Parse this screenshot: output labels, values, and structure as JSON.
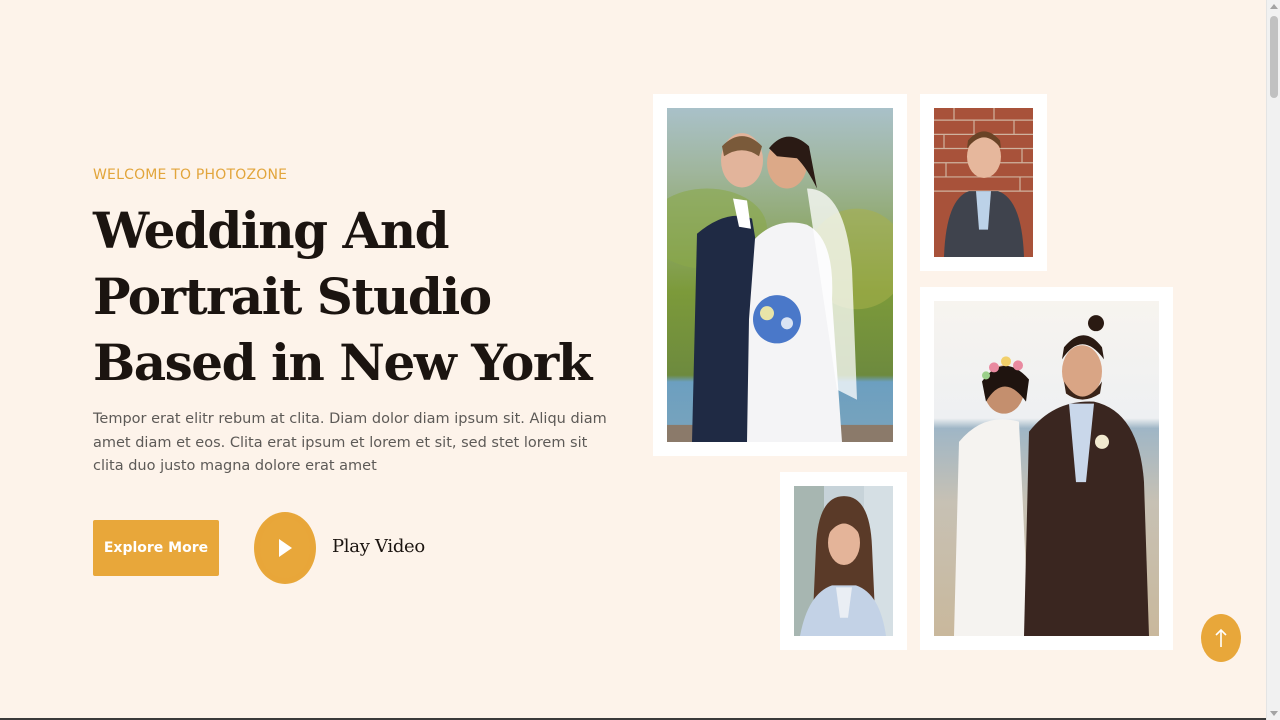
{
  "hero": {
    "eyebrow": "Welcome To Photozone",
    "title": "Wedding And Portrait Studio Based in New York",
    "description": "Tempor erat elitr rebum at clita. Diam dolor diam ipsum sit. Aliqu diam amet diam et eos. Clita erat ipsum et lorem et sit, sed stet lorem sit clita duo justo magna dolore erat amet",
    "explore_label": "Explore More",
    "play_label": "Play Video"
  },
  "gallery": {
    "photos": [
      {
        "name": "wedding-couple-photo",
        "subject": "bride and groom by lake"
      },
      {
        "name": "man-portrait-photo",
        "subject": "man in suit by brick wall"
      },
      {
        "name": "couple-flower-crown-photo",
        "subject": "couple with flower crown"
      },
      {
        "name": "woman-portrait-photo",
        "subject": "smiling woman portrait"
      }
    ]
  },
  "icons": {
    "play": "play-icon",
    "back_to_top": "arrow-up-icon"
  },
  "colors": {
    "accent": "#e8a73a",
    "background": "#fdf3ea",
    "heading": "#1b1410",
    "body_text": "#5d5a57"
  }
}
